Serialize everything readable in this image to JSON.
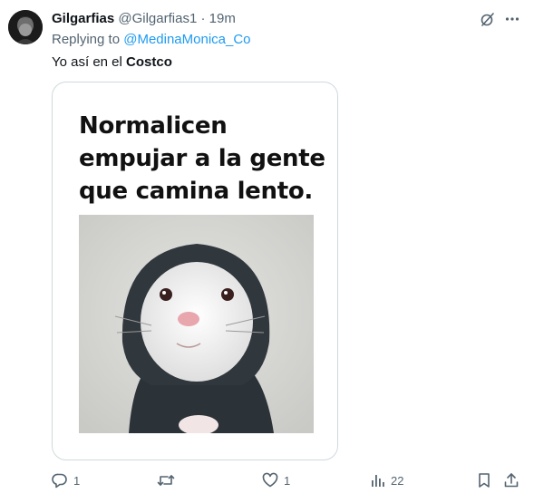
{
  "tweet": {
    "author": {
      "display_name": "Gilgarfias",
      "handle": "@Gilgarfias1",
      "separator": "·",
      "time": "19m"
    },
    "replying_to": {
      "prefix": "Replying to",
      "handle": "@MedinaMonica_Co"
    },
    "text": {
      "before": "Yo así en el ",
      "bold": "Costco"
    },
    "media": {
      "caption_lines": [
        "Normalicen",
        "empujar a la gente",
        "que camina lento."
      ],
      "photo_icon": "hamster-in-hoodie"
    }
  },
  "actions": {
    "reply": {
      "icon": "reply-icon",
      "count": "1"
    },
    "retweet": {
      "icon": "retweet-icon",
      "count": ""
    },
    "like": {
      "icon": "heart-icon",
      "count": "1"
    },
    "views": {
      "icon": "views-icon",
      "count": "22"
    },
    "bookmark": {
      "icon": "bookmark-icon"
    },
    "share": {
      "icon": "share-icon"
    }
  },
  "colors": {
    "text_primary": "#0f1419",
    "text_secondary": "#536471",
    "link": "#1d9bf0",
    "border": "#cfd9de"
  }
}
